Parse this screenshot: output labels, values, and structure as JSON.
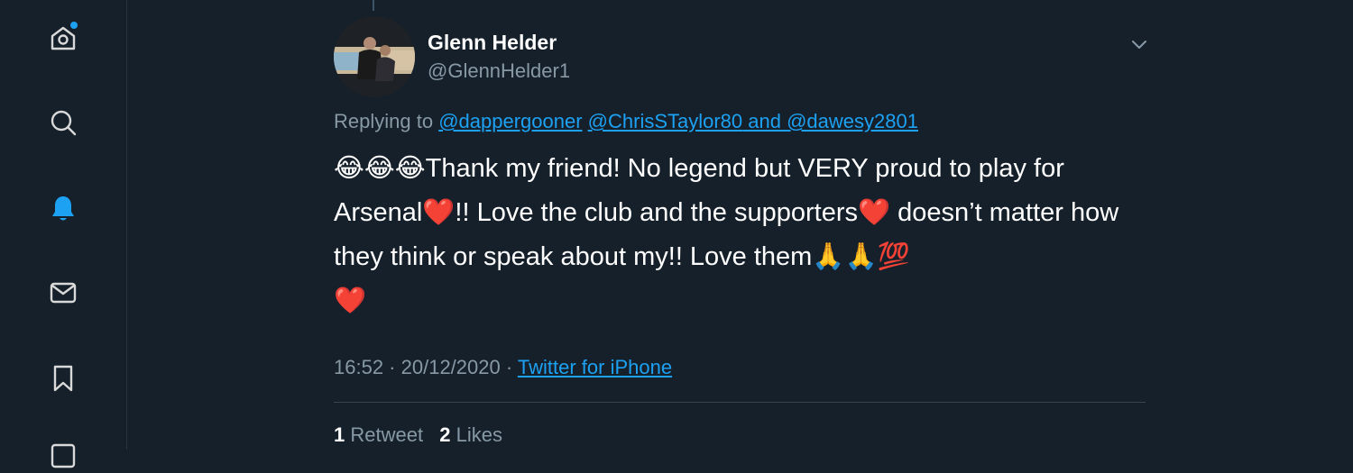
{
  "sidebar": {
    "items": [
      {
        "icon": "home-icon",
        "has_badge": true
      },
      {
        "icon": "search-icon"
      },
      {
        "icon": "bell-icon",
        "active": true
      },
      {
        "icon": "mail-icon"
      },
      {
        "icon": "bookmark-icon"
      }
    ]
  },
  "colors": {
    "background": "#15202b",
    "accent": "#1da1f2",
    "secondary_text": "#8899a6"
  },
  "tweet": {
    "display_name": "Glenn Helder",
    "handle": "@GlennHelder1",
    "replying_prefix": "Replying to ",
    "reply_mention_1": "@dappergooner",
    "reply_mention_2": "@ChrisSTaylor80",
    "reply_and": " and ",
    "reply_mention_3": "@dawesy2801",
    "text": "😂😂😂Thank my friend! No legend but VERY proud to play for Arsenal❤️!! Love the club and the supporters❤️ doesn’t matter how they think or speak about my!! Love them🙏🙏💯\n❤️",
    "time": "16:52",
    "date": "20/12/2020",
    "separator": " · ",
    "source": "Twitter for iPhone",
    "retweets_count": "1",
    "retweets_label": "Retweet",
    "likes_count": "2",
    "likes_label": "Likes"
  }
}
